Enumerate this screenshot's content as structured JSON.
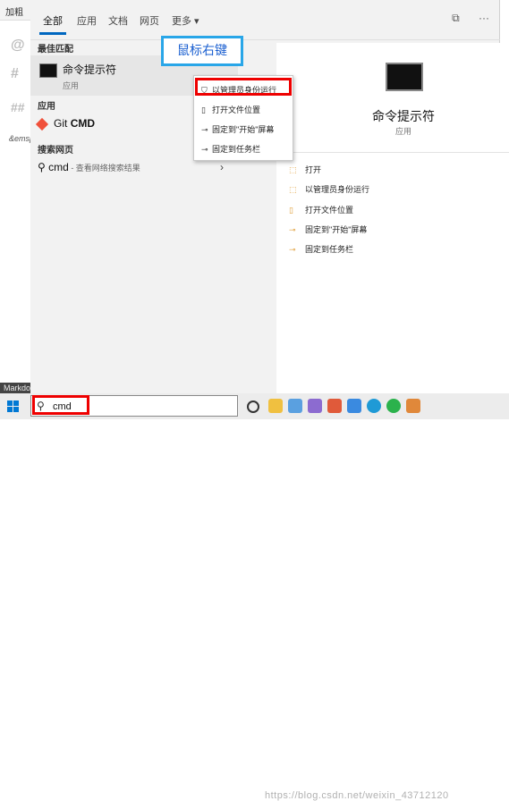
{
  "background": {
    "menu_label": "加粗",
    "glyphs": [
      "@",
      "#",
      "##"
    ],
    "em_text": "&emsp",
    "markdown_tab": "Markdo"
  },
  "tabs": [
    "全部",
    "应用",
    "文档",
    "网页",
    "更多 ▾"
  ],
  "top_icons": [
    "feedback-icon",
    "more-icon"
  ],
  "sections": {
    "best_match": "最佳匹配",
    "apps": "应用",
    "web": "搜索网页"
  },
  "best_match": {
    "title": "命令提示符",
    "subtitle": "应用"
  },
  "apps": [
    {
      "prefix": "Git",
      "title": "CMD"
    }
  ],
  "web_result": {
    "query": "cmd",
    "hint": " - 查看网络搜索结果"
  },
  "annotation": "鼠标右键",
  "context_menu": [
    {
      "label": "以管理员身份运行",
      "icon": "shield-icon"
    },
    {
      "label": "打开文件位置",
      "icon": "folder-open-icon"
    },
    {
      "label": "固定到\"开始\"屏幕",
      "icon": "pin-icon"
    },
    {
      "label": "固定到任务栏",
      "icon": "pin-icon"
    }
  ],
  "detail": {
    "title": "命令提示符",
    "subtitle": "应用",
    "actions": [
      "打开",
      "以管理员身份运行",
      "打开文件位置",
      "固定到\"开始\"屏幕",
      "固定到任务栏"
    ]
  },
  "taskbar": {
    "search_text": "cmd",
    "watermark": "https://blog.csdn.net/weixin_43712120",
    "icons": [
      "task-view-icon",
      "file-explorer-icon",
      "store-icon",
      "app-icon",
      "media-icon",
      "mail-icon",
      "edge-icon",
      "wechat-icon",
      "app-icon-2"
    ]
  },
  "colors": {
    "accent": "#0067c0",
    "highlight": "#e00000",
    "annotation": "#29a6e8"
  }
}
